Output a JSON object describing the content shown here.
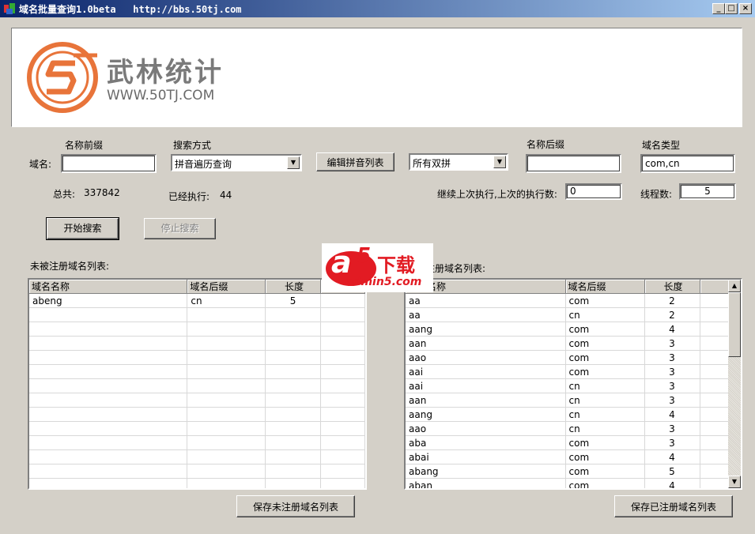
{
  "window": {
    "title": "域名批量查询1.0beta   http://bbs.50tj.com",
    "min_glyph": "_",
    "max_glyph": "□",
    "close_glyph": "×"
  },
  "banner": {
    "logo_cn": "武林统计",
    "logo_en": "WWW.50TJ.COM",
    "logo_color": "#e8743a"
  },
  "form": {
    "prefix_label": "名称前缀",
    "domain_label": "域名:",
    "prefix_value": "",
    "search_mode_label": "搜索方式",
    "search_mode_value": "拼音遍历查询",
    "edit_pinyin_button": "编辑拼音列表",
    "pinyin_mode_value": "所有双拼",
    "suffix_label": "名称后缀",
    "suffix_value": "",
    "domain_type_label": "域名类型",
    "domain_type_value": "com,cn",
    "total_label": "总共:",
    "total_value": "337842",
    "executed_label": "已经执行:",
    "executed_value": "44",
    "resume_label": "继续上次执行,上次的执行数:",
    "resume_value": "0",
    "threads_label": "线程数:",
    "threads_value": "5",
    "start_button": "开始搜索",
    "stop_button": "停止搜索"
  },
  "unregistered": {
    "title": "未被注册域名列表:",
    "columns": [
      "域名名称",
      "域名后缀",
      "长度"
    ],
    "rows": [
      [
        "abeng",
        "cn",
        "5"
      ]
    ],
    "save_button": "保存未注册域名列表"
  },
  "registered": {
    "title": "已被注册域名列表:",
    "columns": [
      "域名名称",
      "域名后缀",
      "长度"
    ],
    "rows": [
      [
        "aa",
        "com",
        "2"
      ],
      [
        "aa",
        "cn",
        "2"
      ],
      [
        "aang",
        "com",
        "4"
      ],
      [
        "aan",
        "com",
        "3"
      ],
      [
        "aao",
        "com",
        "3"
      ],
      [
        "aai",
        "com",
        "3"
      ],
      [
        "aai",
        "cn",
        "3"
      ],
      [
        "aan",
        "cn",
        "3"
      ],
      [
        "aang",
        "cn",
        "4"
      ],
      [
        "aao",
        "cn",
        "3"
      ],
      [
        "aba",
        "com",
        "3"
      ],
      [
        "abai",
        "com",
        "4"
      ],
      [
        "abang",
        "com",
        "5"
      ],
      [
        "aban",
        "com",
        "4"
      ]
    ],
    "save_button": "保存已注册域名列表"
  },
  "watermark": {
    "brand_a": "a",
    "brand_5": "5",
    "brand_text": "下载",
    "site": "admin5.com"
  }
}
